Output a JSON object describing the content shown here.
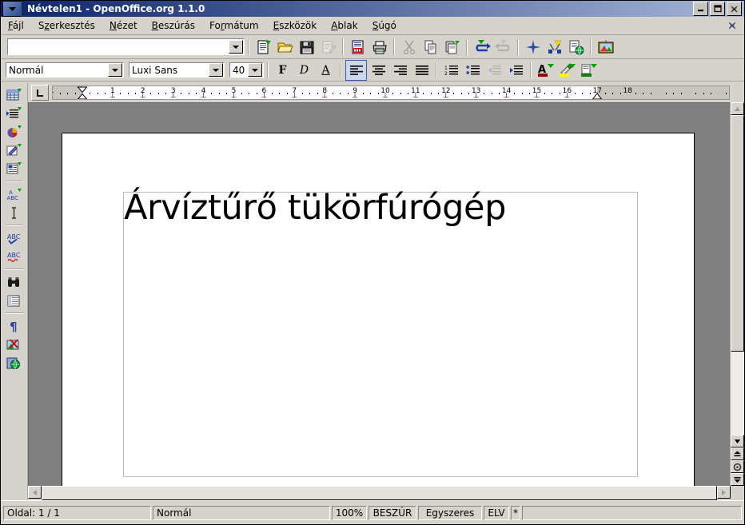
{
  "window": {
    "title": "Névtelen1 - OpenOffice.org 1.1.0",
    "system_menu_icon": "chevron-down-icon",
    "minimize_label": "Minimize",
    "maximize_label": "Maximize",
    "close_label": "Close"
  },
  "menubar": {
    "items": [
      {
        "label": "Fájl",
        "accel": "F"
      },
      {
        "label": "Szerkesztés",
        "accel": "z"
      },
      {
        "label": "Nézet",
        "accel": "N"
      },
      {
        "label": "Beszúrás",
        "accel": "B"
      },
      {
        "label": "Formátum",
        "accel": "r"
      },
      {
        "label": "Eszközök",
        "accel": "E"
      },
      {
        "label": "Ablak",
        "accel": "A"
      },
      {
        "label": "Súgó",
        "accel": "S"
      }
    ],
    "document_close_label": "Dokumentum bezárása"
  },
  "function_toolbar": {
    "url_field": {
      "value": "",
      "placeholder": ""
    },
    "buttons": [
      {
        "name": "new-document-button",
        "tip": "Új",
        "enabled": true
      },
      {
        "name": "open-document-button",
        "tip": "Megnyitás",
        "enabled": true
      },
      {
        "name": "save-document-button",
        "tip": "Mentés",
        "enabled": true
      },
      {
        "name": "edit-file-button",
        "tip": "Fájl szerkesztése",
        "enabled": false
      },
      {
        "name": "export-pdf-button",
        "tip": "Exportálás PDF-be",
        "enabled": true
      },
      {
        "name": "print-file-button",
        "tip": "Fájl nyomtatása közvetlenül",
        "enabled": true
      },
      {
        "name": "cut-button",
        "tip": "Kivágás",
        "enabled": false
      },
      {
        "name": "copy-button",
        "tip": "Másolás",
        "enabled": true
      },
      {
        "name": "paste-button",
        "tip": "Beillesztés",
        "enabled": true
      },
      {
        "name": "undo-button",
        "tip": "Visszavonás",
        "enabled": true
      },
      {
        "name": "redo-button",
        "tip": "Mégis",
        "enabled": false
      },
      {
        "name": "navigator-button",
        "tip": "Navigátor be/ki",
        "enabled": true
      },
      {
        "name": "spellcheck-tools-button",
        "tip": "Helyesírás-ellenőrzés",
        "enabled": true
      },
      {
        "name": "hyperlink-bar-button",
        "tip": "Hiperhivatkozás eszköztár",
        "enabled": true
      },
      {
        "name": "gallery-button",
        "tip": "Képtár",
        "enabled": true
      }
    ]
  },
  "formatting_toolbar": {
    "style_field": {
      "value": "Normál"
    },
    "font_field": {
      "value": "Luxi Sans"
    },
    "size_field": {
      "value": "40"
    },
    "bold_label": "F",
    "italic_label": "D",
    "underline_label": "A",
    "buttons": [
      {
        "name": "align-left-button",
        "tip": "Balra zárt",
        "active": true
      },
      {
        "name": "align-center-button",
        "tip": "Középre zárt",
        "active": false
      },
      {
        "name": "align-right-button",
        "tip": "Jobbra zárt",
        "active": false
      },
      {
        "name": "justify-button",
        "tip": "Sorkizárt",
        "active": false
      },
      {
        "name": "numbered-list-button",
        "tip": "Számozás be/ki",
        "active": false
      },
      {
        "name": "bullet-list-button",
        "tip": "Felsorolás be/ki",
        "active": false
      },
      {
        "name": "decrease-indent-button",
        "tip": "Behúzás csökkentése",
        "enabled": false
      },
      {
        "name": "increase-indent-button",
        "tip": "Behúzás növelése",
        "enabled": true
      },
      {
        "name": "font-color-button",
        "tip": "Betűszín",
        "color": "#8b0000"
      },
      {
        "name": "highlight-button",
        "tip": "Kiemelés",
        "color": "#ffff00"
      },
      {
        "name": "background-color-button",
        "tip": "Háttérszín",
        "color": "#008000"
      }
    ]
  },
  "left_toolbar": {
    "buttons": [
      {
        "name": "insert-table-button",
        "tip": "Táblázat beszúrása"
      },
      {
        "name": "insert-fields-button",
        "tip": "Mezők beszúrása"
      },
      {
        "name": "insert-chart-button",
        "tip": "Diagram beszúrása"
      },
      {
        "name": "draw-functions-button",
        "tip": "Rajzfunkciók megjelenítése"
      },
      {
        "name": "insert-object-button",
        "tip": "Objektum beszúrása"
      },
      {
        "name": "insert-special-character-button",
        "tip": "Különleges karakter"
      },
      {
        "name": "direct-cursor-button",
        "tip": "Közvetlen kurzor be/ki"
      },
      {
        "name": "spellcheck-button",
        "tip": "Helyesírás-ellenőrzés"
      },
      {
        "name": "autospellcheck-button",
        "tip": "Automatikus helyesírás-ellenőrzés"
      },
      {
        "name": "find-replace-button",
        "tip": "Keresés és csere"
      },
      {
        "name": "data-sources-button",
        "tip": "Adatforrások"
      },
      {
        "name": "formatting-marks-button",
        "tip": "Formázási jelek be/ki"
      },
      {
        "name": "images-off-button",
        "tip": "Képek és diagramok be/ki"
      },
      {
        "name": "online-layout-button",
        "tip": "Online elrendezés"
      }
    ]
  },
  "ruler": {
    "tab_selector_icon": "tab-left-icon",
    "unit": "cm",
    "left_numbers": [
      "1"
    ],
    "numbers": [
      "1",
      "2",
      "3",
      "4",
      "5",
      "6",
      "7",
      "8",
      "9",
      "10",
      "11",
      "12",
      "13",
      "14",
      "15",
      "16",
      "17",
      "18"
    ],
    "left_margin_cm": 2,
    "right_margin_cm": 17,
    "left_indent_marker": "hourglass-indent-marker",
    "right_indent_marker": "triangle-indent-marker"
  },
  "document": {
    "text": "Árvíztűrő tükörfúrógép",
    "font_size_pt": 40
  },
  "vertical_scrollbar": {
    "up_arrow": "scroll-up-icon",
    "down_arrow": "scroll-down-icon",
    "previous_page": "previous-page-icon",
    "navigation": "navigation-icon",
    "next_page": "next-page-icon"
  },
  "horizontal_scrollbar": {
    "left_arrow": "scroll-left-icon",
    "right_arrow": "scroll-right-icon"
  },
  "statusbar": {
    "page": "Oldal: 1 / 1",
    "page_style": "Normál",
    "zoom": "100%",
    "insert_mode": "BESZÚR",
    "selection_mode": "Egyszeres",
    "elv": "ELV",
    "modified": "*",
    "empty": ""
  },
  "colors": {
    "titlebar_start": "#0a246a",
    "titlebar_end": "#a6b6d8",
    "chrome": "#d6d2cc",
    "canvas": "#808080",
    "page": "#ffffff",
    "accent": "#3b5fa8"
  }
}
